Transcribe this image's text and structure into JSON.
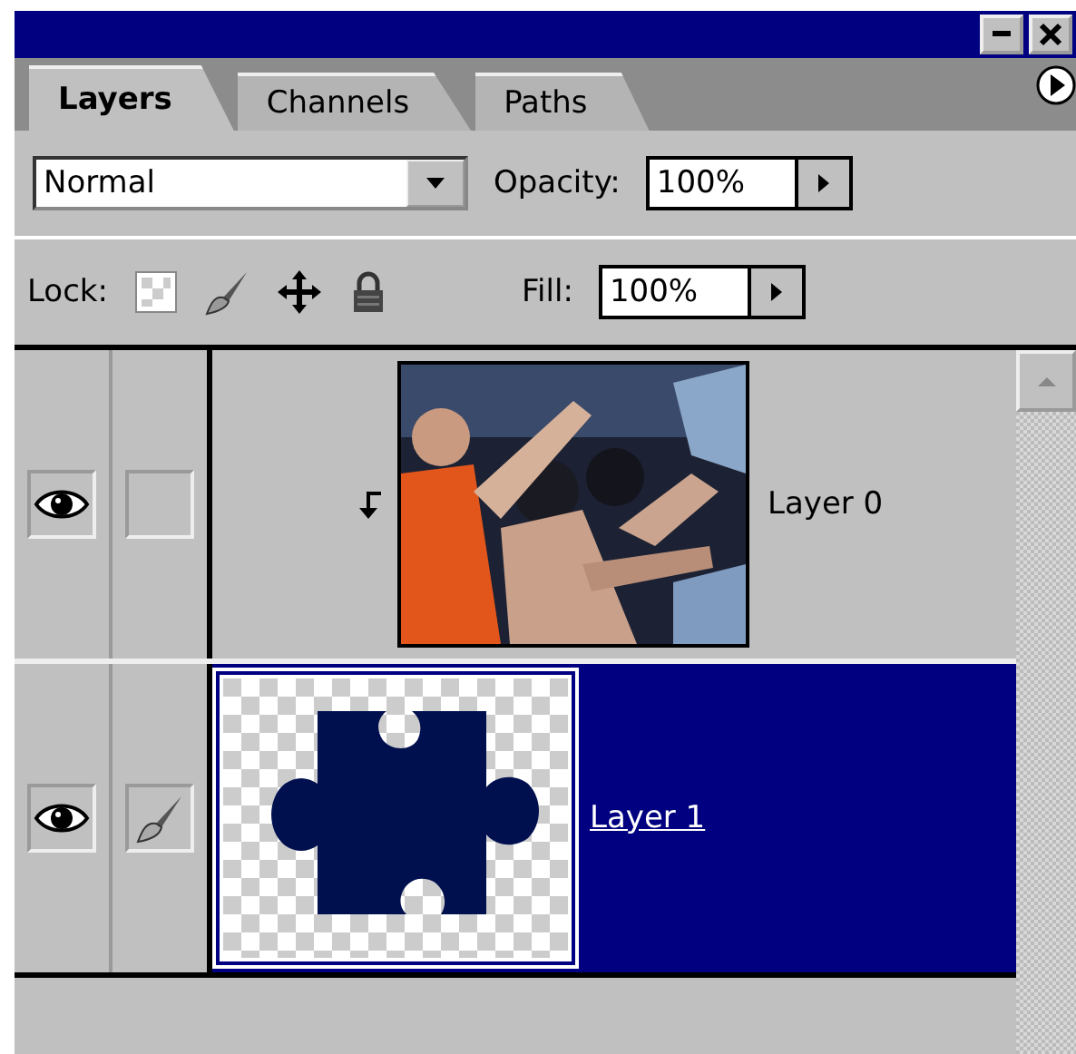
{
  "tabs": [
    {
      "label": "Layers",
      "selected": true
    },
    {
      "label": "Channels",
      "selected": false
    },
    {
      "label": "Paths",
      "selected": false
    }
  ],
  "blend_mode": {
    "value": "Normal"
  },
  "opacity": {
    "label": "Opacity:",
    "value": "100%"
  },
  "lock": {
    "label": "Lock:"
  },
  "fill": {
    "label": "Fill:",
    "value": "100%"
  },
  "layers": [
    {
      "name": "Layer 0",
      "visible": true,
      "brush": false,
      "clipped": true,
      "selected": false
    },
    {
      "name": "Layer 1",
      "visible": true,
      "brush": true,
      "clipped": false,
      "kind": "shape",
      "selected": true
    }
  ]
}
